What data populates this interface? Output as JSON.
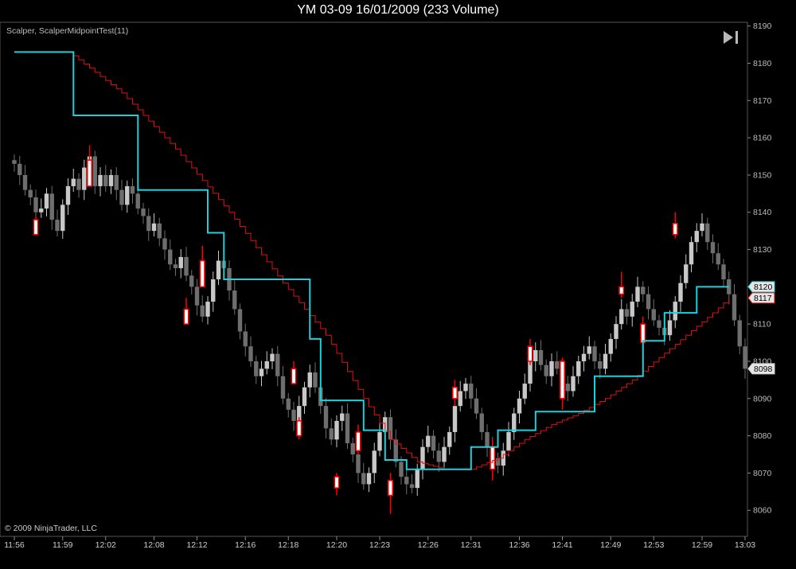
{
  "header": {
    "title": "YM 03-09  16/01/2009 (233 Volume)"
  },
  "indicator_label": "Scalper, ScalperMidpointTest(11)",
  "copyright": "© 2009 NinjaTrader, LLC",
  "icons": {
    "nav": "skip-to-end-icon"
  },
  "colors": {
    "background": "#000000",
    "up_bar": "#c8c8c8",
    "down_bar": "#6e6e6e",
    "signal_bar": "#ff0000",
    "midpoint_line": "#1fd0dc",
    "trail_line": "#e01010",
    "axis": "#888888"
  },
  "chart_data": {
    "type": "candlestick",
    "title": "YM 03-09  16/01/2009 (233 Volume)",
    "ylim": [
      8053,
      8191
    ],
    "y_ticks": [
      8060,
      8070,
      8080,
      8090,
      8100,
      8110,
      8120,
      8130,
      8140,
      8150,
      8160,
      8170,
      8180,
      8190
    ],
    "x_tick_labels": [
      "11:56",
      "11:59",
      "12:02",
      "12:08",
      "12:12",
      "12:16",
      "12:18",
      "12:20",
      "12:23",
      "12:26",
      "12:31",
      "12:36",
      "12:41",
      "12:49",
      "12:53",
      "12:59",
      "13:03"
    ],
    "price_tags": [
      {
        "label": "8120",
        "value": 8120,
        "color": "#1fd0dc"
      },
      {
        "label": "8117",
        "value": 8117,
        "color": "#e01010"
      },
      {
        "label": "8098",
        "value": 8098,
        "color": "#d0d0d0"
      }
    ],
    "candles_close": [
      8153,
      8150,
      8146,
      8144,
      8140,
      8141,
      8145,
      8138,
      8135,
      8142,
      8147,
      8149,
      8146,
      8152,
      8155,
      8147,
      8150,
      8147,
      8150,
      8146,
      8142,
      8147,
      8145,
      8141,
      8139,
      8135,
      8137,
      8133,
      8130,
      8126,
      8125,
      8128,
      8123,
      8120,
      8115,
      8112,
      8116,
      8122,
      8127,
      8125,
      8119,
      8114,
      8108,
      8104,
      8100,
      8096,
      8098,
      8100,
      8102,
      8096,
      8090,
      8087,
      8084,
      8088,
      8093,
      8097,
      8093,
      8088,
      8082,
      8079,
      8084,
      8086,
      8078,
      8075,
      8070,
      8067,
      8070,
      8076,
      8081,
      8085,
      8079,
      8073,
      8069,
      8067,
      8066,
      8071,
      8077,
      8080,
      8076,
      8073,
      8077,
      8081,
      8088,
      8092,
      8094,
      8090,
      8086,
      8081,
      8077,
      8074,
      8072,
      8076,
      8081,
      8086,
      8090,
      8094,
      8100,
      8103,
      8099,
      8096,
      8100,
      8098,
      8094,
      8092,
      8096,
      8100,
      8102,
      8104,
      8100,
      8098,
      8102,
      8106,
      8110,
      8114,
      8112,
      8116,
      8120,
      8118,
      8114,
      8111,
      8109,
      8107,
      8111,
      8116,
      8121,
      8126,
      8132,
      8135,
      8137,
      8132,
      8129,
      8126,
      8122,
      8118,
      8111,
      8104,
      8098
    ],
    "signal_bars": [
      {
        "index": 4,
        "open": 8138,
        "close": 8134,
        "high": 8139,
        "low": 8134
      },
      {
        "index": 14,
        "open": 8154,
        "close": 8147,
        "high": 8158,
        "low": 8147
      },
      {
        "index": 32,
        "open": 8114,
        "close": 8110,
        "high": 8117,
        "low": 8110
      },
      {
        "index": 35,
        "open": 8127,
        "close": 8120,
        "high": 8131,
        "low": 8120
      },
      {
        "index": 52,
        "open": 8098,
        "close": 8094,
        "high": 8100,
        "low": 8094
      },
      {
        "index": 53,
        "open": 8084,
        "close": 8080,
        "high": 8085,
        "low": 8079
      },
      {
        "index": 60,
        "open": 8069,
        "close": 8066,
        "high": 8070,
        "low": 8064
      },
      {
        "index": 64,
        "open": 8081,
        "close": 8076,
        "high": 8083,
        "low": 8075
      },
      {
        "index": 70,
        "open": 8068,
        "close": 8064,
        "high": 8070,
        "low": 8059
      },
      {
        "index": 82,
        "open": 8093,
        "close": 8090,
        "high": 8095,
        "low": 8088
      },
      {
        "index": 89,
        "open": 8077,
        "close": 8071,
        "high": 8079,
        "low": 8068
      },
      {
        "index": 96,
        "open": 8104,
        "close": 8100,
        "high": 8106,
        "low": 8099
      },
      {
        "index": 102,
        "open": 8100,
        "close": 8090,
        "high": 8101,
        "low": 8087
      },
      {
        "index": 113,
        "open": 8120,
        "close": 8118,
        "high": 8124,
        "low": 8117
      },
      {
        "index": 117,
        "open": 8110,
        "close": 8105,
        "high": 8112,
        "low": 8101
      },
      {
        "index": 123,
        "open": 8137,
        "close": 8134,
        "high": 8140,
        "low": 8133
      }
    ],
    "series": [
      {
        "name": "Midpoint",
        "color": "#1fd0dc",
        "steps": [
          {
            "x0": 0,
            "x1": 11,
            "y": 8183
          },
          {
            "x0": 11,
            "x1": 23,
            "y": 8166
          },
          {
            "x0": 23,
            "x1": 36,
            "y": 8146
          },
          {
            "x0": 36,
            "x1": 39,
            "y": 8134.5
          },
          {
            "x0": 39,
            "x1": 55,
            "y": 8122
          },
          {
            "x0": 55,
            "x1": 57,
            "y": 8106
          },
          {
            "x0": 57,
            "x1": 65,
            "y": 8089.5
          },
          {
            "x0": 65,
            "x1": 69,
            "y": 8081.5
          },
          {
            "x0": 69,
            "x1": 73,
            "y": 8073.5
          },
          {
            "x0": 73,
            "x1": 85,
            "y": 8071
          },
          {
            "x0": 85,
            "x1": 90,
            "y": 8077
          },
          {
            "x0": 90,
            "x1": 97,
            "y": 8081.5
          },
          {
            "x0": 97,
            "x1": 108,
            "y": 8086.5
          },
          {
            "x0": 108,
            "x1": 117,
            "y": 8096
          },
          {
            "x0": 117,
            "x1": 121,
            "y": 8105.5
          },
          {
            "x0": 121,
            "x1": 127,
            "y": 8113
          },
          {
            "x0": 127,
            "x1": 133,
            "y": 8120
          }
        ]
      },
      {
        "name": "Trail",
        "color": "#e01010",
        "points": [
          [
            11,
            8182
          ],
          [
            20,
            8172
          ],
          [
            30,
            8157
          ],
          [
            40,
            8140
          ],
          [
            50,
            8121
          ],
          [
            58,
            8107
          ],
          [
            65,
            8090
          ],
          [
            70,
            8079
          ],
          [
            75,
            8073
          ],
          [
            80,
            8071
          ],
          [
            85,
            8071
          ],
          [
            90,
            8074
          ],
          [
            95,
            8079
          ],
          [
            100,
            8083
          ],
          [
            105,
            8086
          ],
          [
            110,
            8090
          ],
          [
            115,
            8095
          ],
          [
            120,
            8101
          ],
          [
            125,
            8107
          ],
          [
            130,
            8113
          ],
          [
            133,
            8117
          ]
        ]
      }
    ]
  }
}
